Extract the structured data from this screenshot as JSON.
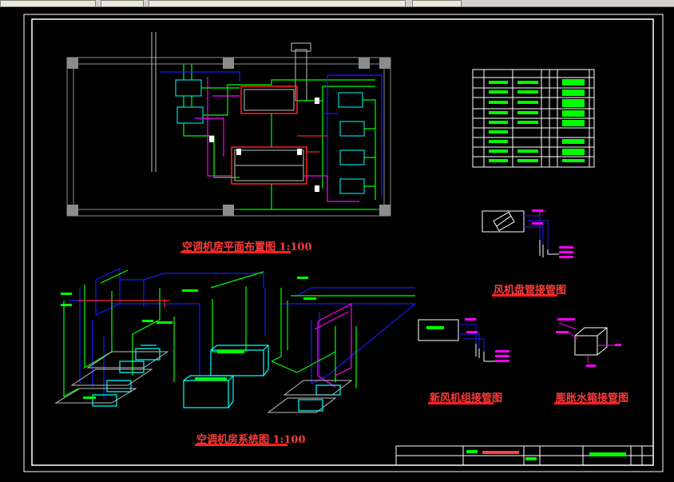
{
  "titles": {
    "plan": "空调机房平面布置图 1:100",
    "system": "空调机房系统图 1:100",
    "fancoil": "风机盘管接管图",
    "freshair": "新风机组接管图",
    "expansion": "膨胀水箱接管图"
  },
  "colors": {
    "background": "#000000",
    "green": "#00ff00",
    "blue": "#1a1aff",
    "magenta": "#ff00ff",
    "red": "#ff2020",
    "white": "#ffffff",
    "cyan": "#00ffff",
    "gray": "#8c8c8c",
    "olive": "#9c9c00"
  },
  "icons": [
    "toolbar-buttons-icon",
    "pump-icon",
    "column-icon",
    "tank-icon"
  ]
}
